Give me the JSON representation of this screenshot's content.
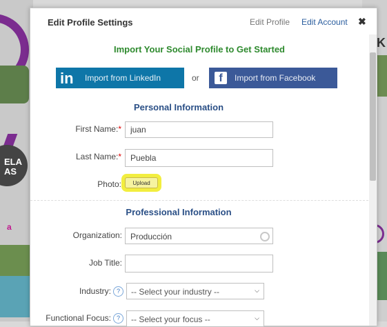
{
  "header": {
    "title": "Edit Profile Settings",
    "edit_profile": "Edit Profile",
    "edit_account": "Edit Account",
    "close": "✖"
  },
  "import": {
    "title": "Import Your Social Profile to Get Started",
    "linkedin_logo": "in",
    "linkedin_label": "Import from LinkedIn",
    "or": "or",
    "facebook_logo": "f",
    "facebook_label": "Import from Facebook"
  },
  "personal": {
    "title": "Personal Information",
    "first_name_label": "First Name:",
    "first_name_value": "juan",
    "last_name_label": "Last Name:",
    "last_name_value": "Puebla",
    "required_mark": "*",
    "photo_label": "Photo:",
    "upload_label": "Upload"
  },
  "professional": {
    "title": "Professional Information",
    "organization_label": "Organization:",
    "organization_value": "Producción",
    "job_title_label": "Job Title:",
    "job_title_value": "",
    "industry_label": "Industry:",
    "industry_selected": "-- Select your industry --",
    "functional_label": "Functional Focus:",
    "functional_selected": "-- Select your focus --",
    "help_glyph": "?"
  },
  "background": {
    "left_logo": "ELA\nAS",
    "right_logo": "K",
    "left_pink": "a"
  },
  "colors": {
    "linkedin": "#0e76a8",
    "facebook": "#3b5998",
    "import_title": "#2e8a2e",
    "section_title": "#2a4f86",
    "highlight": "#f2ee3f"
  }
}
